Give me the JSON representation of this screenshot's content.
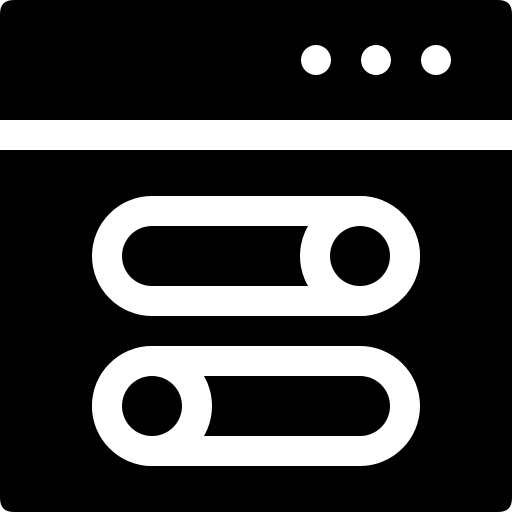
{
  "icon": {
    "name": "settings-window-toggles-icon",
    "foreground": "#000000",
    "background": "#ffffff"
  },
  "window": {
    "title_bar": {
      "dots": [
        "dot",
        "dot",
        "dot"
      ]
    }
  },
  "toggles": [
    {
      "name": "toggle-switch-top",
      "state": "on",
      "knob_side": "right"
    },
    {
      "name": "toggle-switch-bottom",
      "state": "off",
      "knob_side": "left"
    }
  ]
}
